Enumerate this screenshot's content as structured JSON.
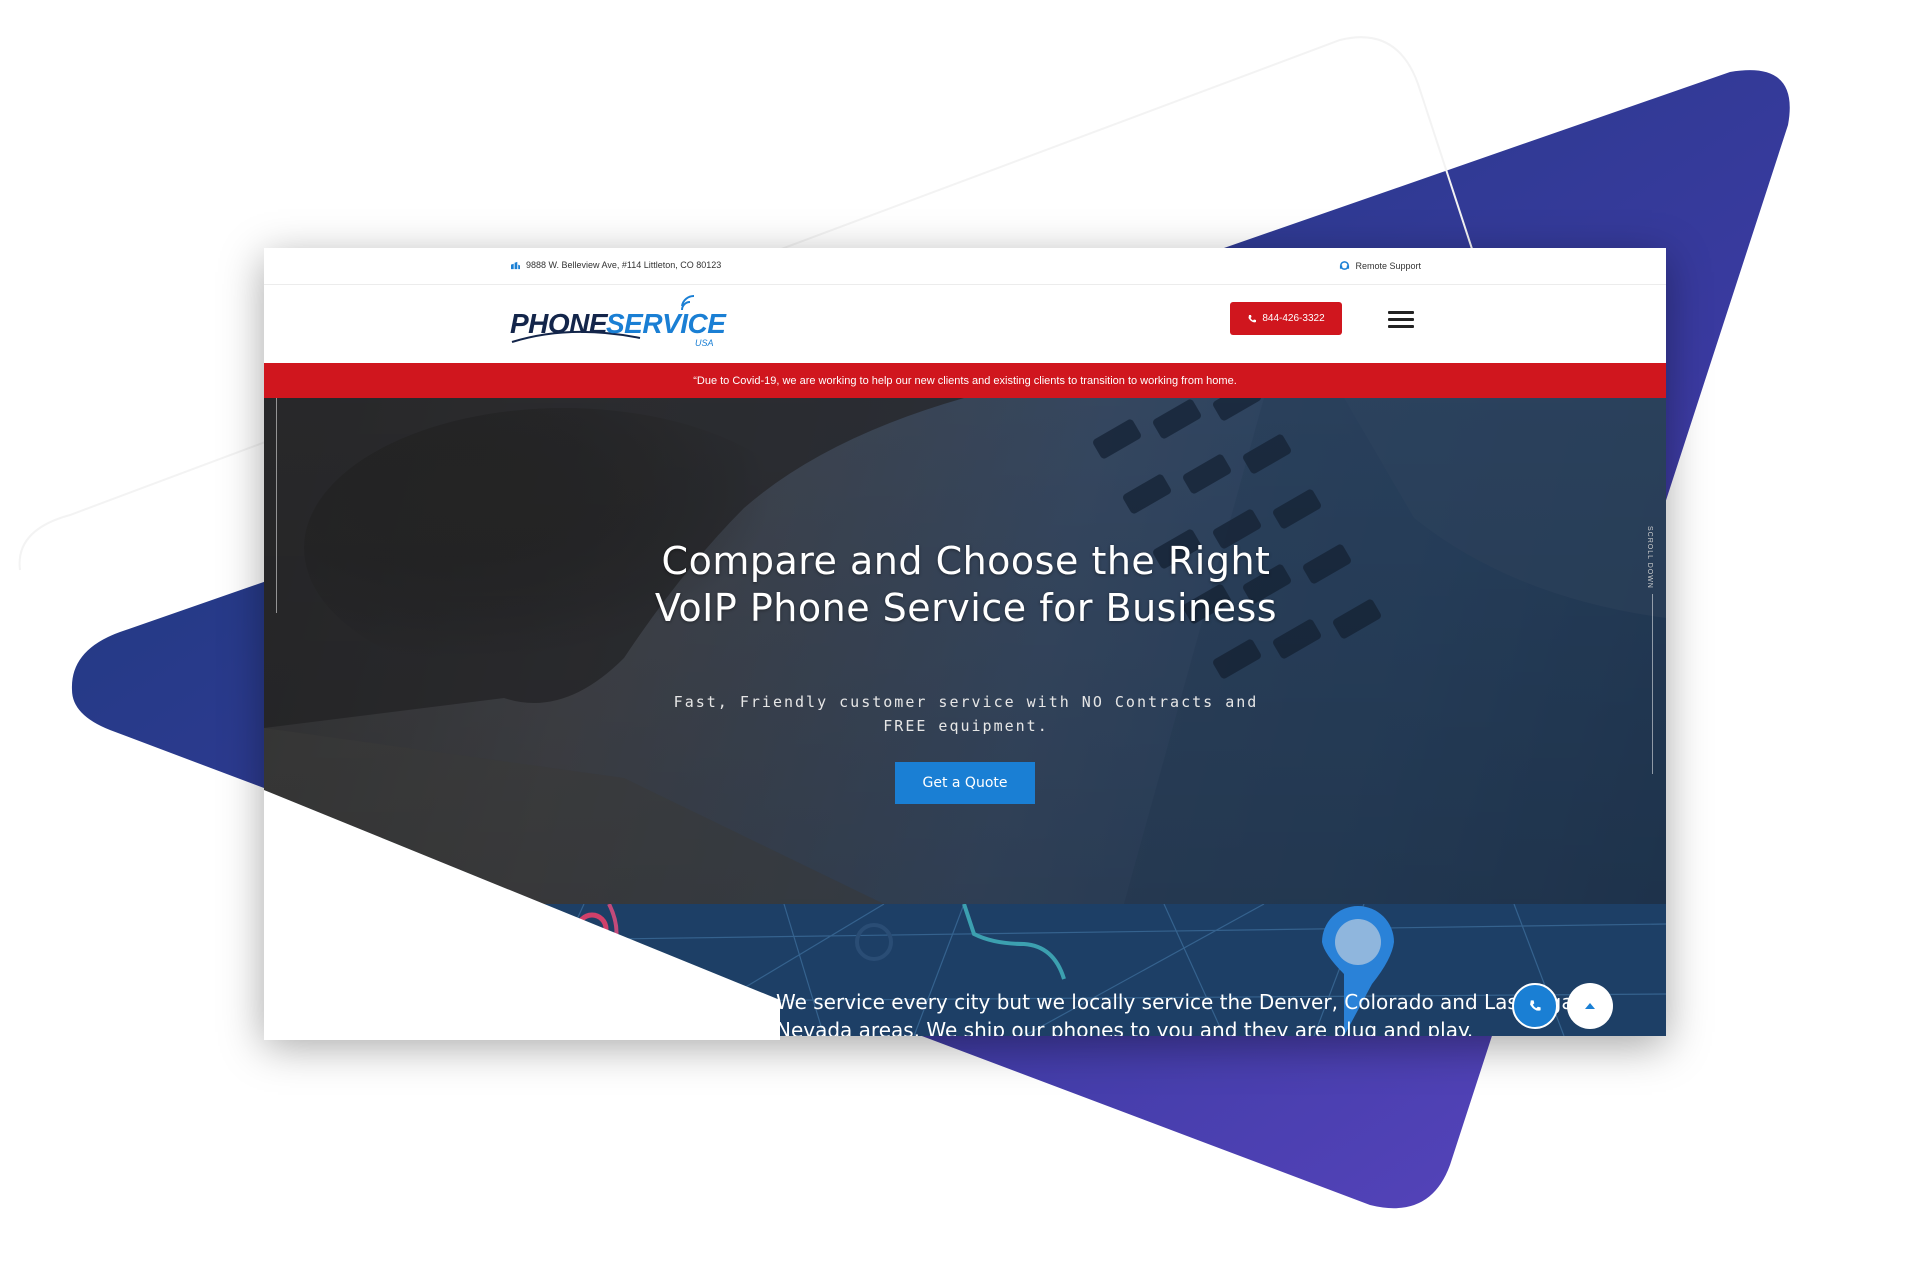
{
  "topbar": {
    "address": "9888 W. Belleview Ave, #114 Littleton, CO 80123",
    "support_label": "Remote Support"
  },
  "logo": {
    "word1": "PHONE",
    "word2": "SERVICE",
    "word3": "USA"
  },
  "header": {
    "call_label": "844-426-3322"
  },
  "alert": {
    "text": "“Due to Covid-19, we are working to help our new clients and existing clients to transition to working from home."
  },
  "hero": {
    "title": "Compare and Choose the Right VoIP Phone Service for Business",
    "subtitle": "Fast, Friendly customer service with NO Contracts and FREE equipment.",
    "cta_label": "Get a Quote",
    "scroll_label": "SCROLL DOWN"
  },
  "map_section": {
    "text": "We service every city but we locally service the Denver, Colorado and Las Vegas, Nevada areas. We ship our phones to you and they are plug and play."
  },
  "colors": {
    "brand_red": "#d0161e",
    "brand_blue": "#1a7fd4",
    "navy": "#13254a",
    "triangle_start": "#163a74",
    "triangle_end": "#5b45c0"
  },
  "icons": [
    "map-marker-icon",
    "headset-icon",
    "phone-icon",
    "menu-icon",
    "arrow-up-icon",
    "location-pin-icon"
  ]
}
